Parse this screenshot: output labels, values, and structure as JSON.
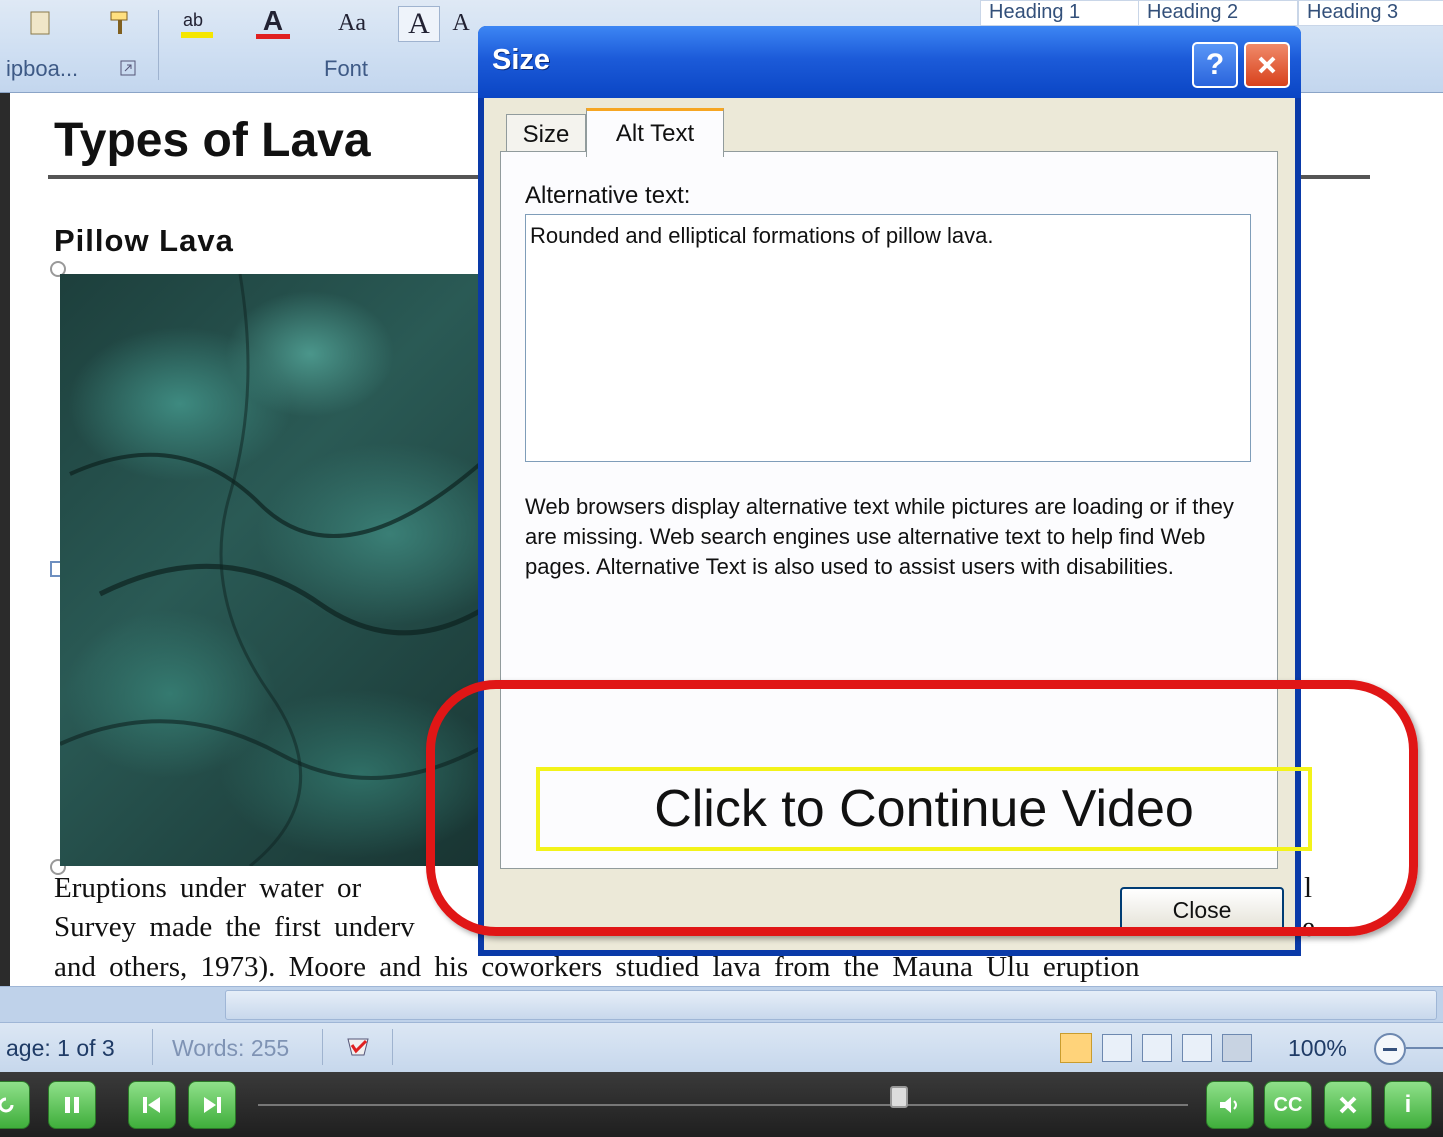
{
  "ribbon": {
    "clipboard_label": "ipboa...",
    "font_label": "Font",
    "grow_glyph": "A",
    "shrink_glyph": "A",
    "case_glyph": "Aa",
    "font_color_glyph": "A",
    "styles": [
      "Heading 1",
      "Heading 2",
      "Heading 3"
    ]
  },
  "document": {
    "title": "Types of Lava",
    "subtitle": "Pillow Lava",
    "image_alt": "Rounded and elliptical formations of pillow lava.",
    "lines": [
      "Eruptions under water or",
      "Survey made the first underv",
      "and others, 1973). Moore and his coworkers studied lava from the Mauna Ulu eruption"
    ],
    "line_tail_1": "l",
    "line_tail_2": "e"
  },
  "statusbar": {
    "page": "age: 1 of 3",
    "words": "Words: 255",
    "zoom": "100%"
  },
  "dialog": {
    "title": "Size",
    "help_button": "?",
    "close_x": "X",
    "tabs": [
      "Size",
      "Alt Text"
    ],
    "active_tab": "Alt Text",
    "alt_label": "Alternative text:",
    "alt_value": "Rounded and elliptical formations of pillow lava.",
    "help_text": "Web browsers display alternative text while pictures are loading or if they are missing.  Web search engines use alternative text to help find Web pages.  Alternative Text is also used to assist users with disabilities.",
    "close_button": "Close"
  },
  "overlay": {
    "continue_label": "Click to Continue Video"
  },
  "player": {
    "buttons": [
      "replay",
      "pause",
      "previous",
      "next",
      "volume",
      "CC",
      "close",
      "info"
    ],
    "cc_label": "CC",
    "info_label": "i"
  },
  "colors": {
    "highlight_ring": "#e01616",
    "continue_border": "#f3f31a",
    "titlebar": "#1c5bd9",
    "player_button": "#4fbf4a"
  }
}
